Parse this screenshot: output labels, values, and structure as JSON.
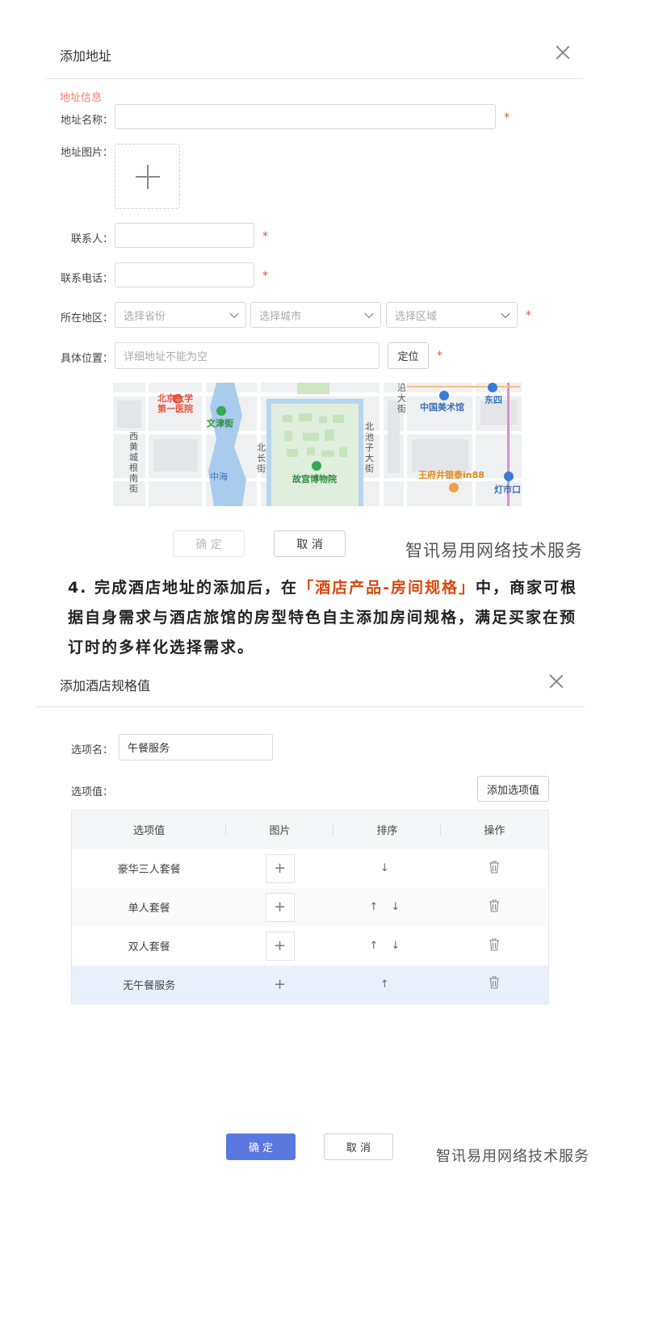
{
  "dialog1": {
    "title": "添加地址",
    "section_label": "地址信息",
    "fields": {
      "name_label": "地址名称：",
      "image_label": "地址图片：",
      "contact_label": "联系人：",
      "phone_label": "联系电话：",
      "region_label": "所在地区：",
      "location_label": "具体位置："
    },
    "required_mark": "*",
    "province_placeholder": "选择省份",
    "city_placeholder": "选择城市",
    "district_placeholder": "选择区域",
    "address_placeholder": "详细地址不能为空",
    "locate_button": "定位",
    "confirm_button": "确 定",
    "cancel_button": "取 消"
  },
  "map_labels": {
    "hospital": "北京大学\n第一医院",
    "wenjin": "文津街",
    "xihuang": "西\n黄\n城\n根\n南\n街",
    "zhonghai": "中海",
    "beichang": "北\n长\n街",
    "museum": "故宫博物院",
    "beichi": "北\n池\n子\n大\n街",
    "yan": "沿\n大\n街",
    "art": "中国美术馆",
    "dongsi": "东四",
    "wangfujing": "王府井银泰in88",
    "dengshikou": "灯市口"
  },
  "watermark": "智讯易用网络技术服务",
  "paragraph": {
    "before": "4. 完成酒店地址的添加后，在",
    "highlight": "「酒店产品-房间规格」",
    "after": "中，商家可根据自身需求与酒店旅馆的房型特色自主添加房间规格，满足买家在预订时的多样化选择需求。"
  },
  "dialog2": {
    "title": "添加酒店规格值",
    "option_name_label": "选项名：",
    "option_name_value": "午餐服务",
    "option_values_label": "选项值：",
    "add_option_button": "添加选项值",
    "columns": [
      "选项值",
      "图片",
      "排序",
      "操作"
    ],
    "rows": [
      {
        "value": "豪华三人套餐",
        "sort": "↓"
      },
      {
        "value": "单人套餐",
        "sort": "↑ ↓"
      },
      {
        "value": "双人套餐",
        "sort": "↑ ↓"
      },
      {
        "value": "无午餐服务",
        "sort": "↑"
      }
    ],
    "confirm_button": "确 定",
    "cancel_button": "取 消"
  },
  "colors": {
    "accent": "#5b78e0",
    "required": "#e5533d",
    "highlight": "#d9480f"
  }
}
